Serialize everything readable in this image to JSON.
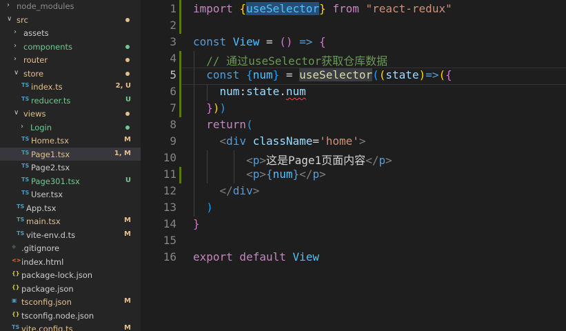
{
  "explorer": {
    "rows": [
      {
        "name": "node_modules",
        "type": "folder",
        "expanded": false,
        "depth": 0,
        "color": "#8b8b8b",
        "status": "",
        "dot": ""
      },
      {
        "name": "src",
        "type": "folder",
        "expanded": true,
        "depth": 0,
        "color": "#e2c08d",
        "status": "",
        "dot": "#e2c08d"
      },
      {
        "name": "assets",
        "type": "folder",
        "expanded": false,
        "depth": 1,
        "color": "#cccccc",
        "status": "",
        "dot": ""
      },
      {
        "name": "components",
        "type": "folder",
        "expanded": false,
        "depth": 1,
        "color": "#73c991",
        "status": "",
        "dot": "#73c991"
      },
      {
        "name": "router",
        "type": "folder",
        "expanded": false,
        "depth": 1,
        "color": "#e2c08d",
        "status": "",
        "dot": "#e2c08d"
      },
      {
        "name": "store",
        "type": "folder",
        "expanded": true,
        "depth": 1,
        "color": "#e2c08d",
        "status": "",
        "dot": "#e2c08d"
      },
      {
        "name": "index.ts",
        "type": "ts",
        "depth": 2,
        "color": "#e2c08d",
        "status": "2, U",
        "statusColor": "#e2c08d",
        "dot": ""
      },
      {
        "name": "reducer.ts",
        "type": "ts",
        "depth": 2,
        "color": "#73c991",
        "status": "U",
        "statusColor": "#73c991",
        "dot": ""
      },
      {
        "name": "views",
        "type": "folder",
        "expanded": true,
        "depth": 1,
        "color": "#e2c08d",
        "status": "",
        "dot": "#e2c08d"
      },
      {
        "name": "Login",
        "type": "folder",
        "expanded": false,
        "depth": 2,
        "color": "#73c991",
        "status": "",
        "dot": "#73c991"
      },
      {
        "name": "Home.tsx",
        "type": "ts",
        "depth": 2,
        "color": "#e2c08d",
        "status": "M",
        "statusColor": "#e2c08d",
        "dot": ""
      },
      {
        "name": "Page1.tsx",
        "type": "ts",
        "depth": 2,
        "color": "#e2c08d",
        "status": "1, M",
        "statusColor": "#e2c08d",
        "dot": "",
        "selected": true
      },
      {
        "name": "Page2.tsx",
        "type": "ts",
        "depth": 2,
        "color": "#cccccc",
        "status": "",
        "dot": ""
      },
      {
        "name": "Page301.tsx",
        "type": "ts",
        "depth": 2,
        "color": "#73c991",
        "status": "U",
        "statusColor": "#73c991",
        "dot": ""
      },
      {
        "name": "User.tsx",
        "type": "ts",
        "depth": 2,
        "color": "#cccccc",
        "status": "",
        "dot": ""
      },
      {
        "name": "App.tsx",
        "type": "ts",
        "depth": 1,
        "color": "#cccccc",
        "status": "",
        "dot": ""
      },
      {
        "name": "main.tsx",
        "type": "ts",
        "depth": 1,
        "color": "#e2c08d",
        "status": "M",
        "statusColor": "#e2c08d",
        "dot": ""
      },
      {
        "name": "vite-env.d.ts",
        "type": "ts",
        "depth": 1,
        "color": "#cccccc",
        "status": "M",
        "statusColor": "#e2c08d",
        "dot": ""
      },
      {
        "name": ".gitignore",
        "type": "git",
        "depth": 0,
        "color": "#cccccc",
        "status": "",
        "dot": ""
      },
      {
        "name": "index.html",
        "type": "html",
        "depth": 0,
        "color": "#cccccc",
        "status": "",
        "dot": ""
      },
      {
        "name": "package-lock.json",
        "type": "json",
        "depth": 0,
        "color": "#cccccc",
        "status": "",
        "dot": ""
      },
      {
        "name": "package.json",
        "type": "json",
        "depth": 0,
        "color": "#cccccc",
        "status": "",
        "dot": ""
      },
      {
        "name": "tsconfig.json",
        "type": "tsconfig",
        "depth": 0,
        "color": "#e2c08d",
        "status": "M",
        "statusColor": "#e2c08d",
        "dot": ""
      },
      {
        "name": "tsconfig.node.json",
        "type": "json",
        "depth": 0,
        "color": "#cccccc",
        "status": "",
        "dot": ""
      },
      {
        "name": "vite.config.ts",
        "type": "ts",
        "depth": 0,
        "color": "#e2c08d",
        "status": "M",
        "statusColor": "#e2c08d",
        "dot": ""
      }
    ],
    "icon_labels": {
      "ts": "TS",
      "git": "◆",
      "html": "<>",
      "json": "{}",
      "tsconfig": "▣"
    },
    "chevrons": {
      "open": "∨",
      "closed": "›"
    }
  },
  "editor": {
    "line_numbers": [
      "1",
      "2",
      "3",
      "4",
      "5",
      "6",
      "7",
      "8",
      "9",
      "10",
      "11",
      "12",
      "13",
      "14",
      "15",
      "16"
    ],
    "active_line": 5,
    "lines": [
      [
        [
          "kw2",
          "import "
        ],
        [
          "br1",
          "{"
        ],
        [
          "hl var",
          "useSelector"
        ],
        [
          "br1",
          "}"
        ],
        [
          "kw2",
          " from "
        ],
        [
          "str",
          "\"react-redux\""
        ]
      ],
      [],
      [
        [
          "kw",
          "const "
        ],
        [
          "var",
          "View"
        ],
        [
          "txt",
          " = "
        ],
        [
          "br2",
          "()"
        ],
        [
          "kw",
          " => "
        ],
        [
          "br2",
          "{"
        ]
      ],
      [
        [
          "txt",
          "  "
        ],
        [
          "cmt",
          "// 通过useSelector获取仓库数据"
        ]
      ],
      [
        [
          "txt",
          "  "
        ],
        [
          "kw",
          "const "
        ],
        [
          "br3",
          "{"
        ],
        [
          "var",
          "num"
        ],
        [
          "br3",
          "}"
        ],
        [
          "txt",
          " = "
        ],
        [
          "hl2 fn",
          "useSelector"
        ],
        [
          "br3",
          "("
        ],
        [
          "br1",
          "("
        ],
        [
          "prop",
          "state"
        ],
        [
          "br1",
          ")"
        ],
        [
          "kw",
          "=>"
        ],
        [
          "br1",
          "("
        ],
        [
          "br2",
          "{"
        ]
      ],
      [
        [
          "txt",
          "    "
        ],
        [
          "prop",
          "num"
        ],
        [
          "txt",
          ":"
        ],
        [
          "prop",
          "state"
        ],
        [
          "txt",
          "."
        ],
        [
          "prop squig",
          "num"
        ]
      ],
      [
        [
          "txt",
          "  "
        ],
        [
          "br2",
          "}"
        ],
        [
          "br1",
          ")"
        ],
        [
          "br3",
          ")"
        ]
      ],
      [
        [
          "txt",
          "  "
        ],
        [
          "kw2",
          "return"
        ],
        [
          "br3",
          "("
        ]
      ],
      [
        [
          "txt",
          "    "
        ],
        [
          "punct",
          "<"
        ],
        [
          "tag",
          "div"
        ],
        [
          "txt",
          " "
        ],
        [
          "prop",
          "className"
        ],
        [
          "txt",
          "="
        ],
        [
          "str",
          "'home'"
        ],
        [
          "punct",
          ">"
        ]
      ],
      [
        [
          "txt",
          "        "
        ],
        [
          "punct",
          "<"
        ],
        [
          "tag",
          "p"
        ],
        [
          "punct",
          ">"
        ],
        [
          "txt",
          "这是Page1页面内容"
        ],
        [
          "punct",
          "</"
        ],
        [
          "tag",
          "p"
        ],
        [
          "punct",
          ">"
        ]
      ],
      [
        [
          "txt",
          "        "
        ],
        [
          "punct",
          "<"
        ],
        [
          "tag",
          "p"
        ],
        [
          "punct",
          ">"
        ],
        [
          "kw",
          "{"
        ],
        [
          "var",
          "num"
        ],
        [
          "kw",
          "}"
        ],
        [
          "punct",
          "</"
        ],
        [
          "tag",
          "p"
        ],
        [
          "punct",
          ">"
        ]
      ],
      [
        [
          "txt",
          "    "
        ],
        [
          "punct",
          "</"
        ],
        [
          "tag",
          "div"
        ],
        [
          "punct",
          ">"
        ]
      ],
      [
        [
          "txt",
          "  "
        ],
        [
          "br3",
          ")"
        ]
      ],
      [
        [
          "br2",
          "}"
        ]
      ],
      [],
      [
        [
          "kw2",
          "export default "
        ],
        [
          "var",
          "View"
        ]
      ]
    ]
  }
}
